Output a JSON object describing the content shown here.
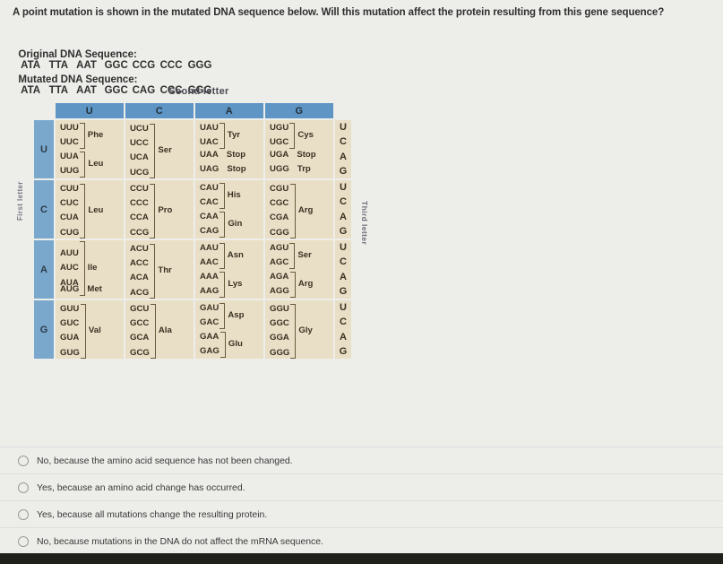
{
  "question": {
    "prompt": "A point mutation is shown in the mutated DNA sequence below. Will this mutation affect the protein resulting from this gene sequence?",
    "original_label": "Original DNA Sequence:",
    "mutated_label": "Mutated DNA Sequence:",
    "original_codons": [
      "ATA",
      "TTA",
      "AAT",
      "GGC",
      "CCG",
      "CCC",
      "GGG"
    ],
    "mutated_codons": [
      "ATA",
      "TTA",
      "AAT",
      "GGC",
      "CAG",
      "CCC",
      "GGG"
    ]
  },
  "codon_chart": {
    "second_letter_label": "Seond letter",
    "first_letter_label": "First letter",
    "third_letter_label": "Third letter",
    "column_headers": [
      "U",
      "C",
      "A",
      "G"
    ],
    "row_labels": [
      "U",
      "C",
      "A",
      "G"
    ],
    "third_letters": [
      "U",
      "C",
      "A",
      "G"
    ],
    "cells": {
      "UU": {
        "mode": "grouped",
        "groups": [
          {
            "codons": [
              "UUU",
              "UUC"
            ],
            "aa": "Phe"
          },
          {
            "codons": [
              "UUA",
              "UUG"
            ],
            "aa": "Leu"
          }
        ]
      },
      "UC": {
        "mode": "single",
        "groups": [
          {
            "codons": [
              "UCU",
              "UCC",
              "UCA",
              "UCG"
            ],
            "aa": "Ser"
          }
        ]
      },
      "UA": {
        "mode": "mixed",
        "groups": [
          {
            "codons": [
              "UAU",
              "UAC"
            ],
            "aa": "Tyr"
          }
        ],
        "flat": [
          {
            "codon": "UAA",
            "aa": "Stop"
          },
          {
            "codon": "UAG",
            "aa": "Stop"
          }
        ]
      },
      "UG": {
        "mode": "mixed",
        "groups": [
          {
            "codons": [
              "UGU",
              "UGC"
            ],
            "aa": "Cys"
          }
        ],
        "flat": [
          {
            "codon": "UGA",
            "aa": "Stop"
          },
          {
            "codon": "UGG",
            "aa": "Trp"
          }
        ]
      },
      "CU": {
        "mode": "single",
        "groups": [
          {
            "codons": [
              "CUU",
              "CUC",
              "CUA",
              "CUG"
            ],
            "aa": "Leu"
          }
        ]
      },
      "CC": {
        "mode": "single",
        "groups": [
          {
            "codons": [
              "CCU",
              "CCC",
              "CCA",
              "CCG"
            ],
            "aa": "Pro"
          }
        ]
      },
      "CA": {
        "mode": "grouped",
        "groups": [
          {
            "codons": [
              "CAU",
              "CAC"
            ],
            "aa": "His"
          },
          {
            "codons": [
              "CAA",
              "CAG"
            ],
            "aa": "Gin"
          }
        ]
      },
      "CG": {
        "mode": "single",
        "groups": [
          {
            "codons": [
              "CGU",
              "CGC",
              "CGA",
              "CGG"
            ],
            "aa": "Arg"
          }
        ]
      },
      "AU": {
        "mode": "mixed",
        "groups": [
          {
            "codons": [
              "AUU",
              "AUC",
              "AUA"
            ],
            "aa": "Ile"
          }
        ],
        "flat": [
          {
            "codon": "AUG",
            "aa": "Met"
          }
        ]
      },
      "AC": {
        "mode": "single",
        "groups": [
          {
            "codons": [
              "ACU",
              "ACC",
              "ACA",
              "ACG"
            ],
            "aa": "Thr"
          }
        ]
      },
      "AA": {
        "mode": "grouped",
        "groups": [
          {
            "codons": [
              "AAU",
              "AAC"
            ],
            "aa": "Asn"
          },
          {
            "codons": [
              "AAA",
              "AAG"
            ],
            "aa": "Lys"
          }
        ]
      },
      "AG": {
        "mode": "grouped",
        "groups": [
          {
            "codons": [
              "AGU",
              "AGC"
            ],
            "aa": "Ser"
          },
          {
            "codons": [
              "AGA",
              "AGG"
            ],
            "aa": "Arg"
          }
        ]
      },
      "GU": {
        "mode": "single",
        "groups": [
          {
            "codons": [
              "GUU",
              "GUC",
              "GUA",
              "GUG"
            ],
            "aa": "Val"
          }
        ]
      },
      "GC": {
        "mode": "single",
        "groups": [
          {
            "codons": [
              "GCU",
              "GCC",
              "GCA",
              "GCG"
            ],
            "aa": "Ala"
          }
        ]
      },
      "GA": {
        "mode": "grouped",
        "groups": [
          {
            "codons": [
              "GAU",
              "GAC"
            ],
            "aa": "Asp"
          },
          {
            "codons": [
              "GAA",
              "GAG"
            ],
            "aa": "Glu"
          }
        ]
      },
      "GG": {
        "mode": "single",
        "groups": [
          {
            "codons": [
              "GGU",
              "GGC",
              "GGA",
              "GGG"
            ],
            "aa": "Gly"
          }
        ]
      }
    },
    "colors": {
      "header_blue": "#5e95c4",
      "row_label_blue": "#7aa8cd",
      "cell_cream": "#e9dfc6",
      "bracket": "#6a5a3e"
    }
  },
  "answers": [
    {
      "text": "No, because the amino acid sequence has not been changed.",
      "selected": false
    },
    {
      "text": "Yes, because an amino acid change has occurred.",
      "selected": false
    },
    {
      "text": "Yes, because all mutations change the resulting protein.",
      "selected": false
    },
    {
      "text": "No, because mutations in the DNA do not affect the mRNA sequence.",
      "selected": false
    }
  ],
  "page": {
    "background": "#edeeea",
    "bottom_bar_color": "#1e2019"
  }
}
